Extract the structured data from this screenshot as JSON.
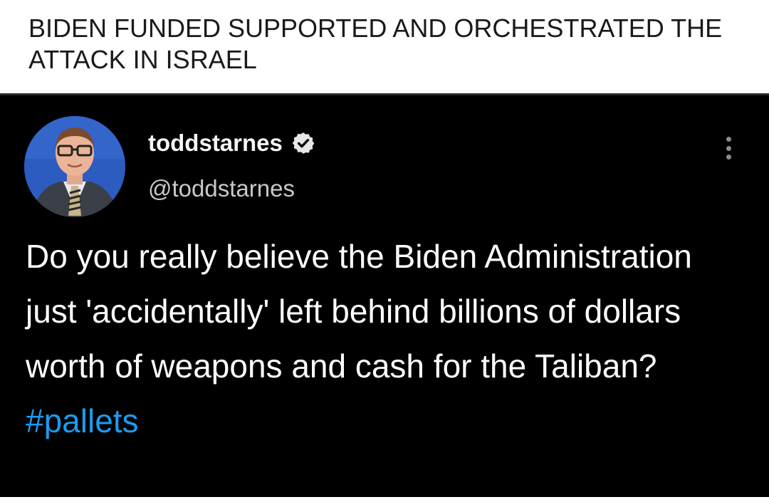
{
  "post": {
    "title": "BIDEN FUNDED SUPPORTED AND ORCHESTRATED THE ATTACK IN ISRAEL"
  },
  "tweet": {
    "display_name": "toddstarnes",
    "handle": "@toddstarnes",
    "verified_icon": "verified-badge-icon",
    "more_icon": "vertical-ellipsis-icon",
    "text": "Do you really believe the Biden Administration just 'accidentally' left behind billions of dollars worth of weapons and cash for the Taliban?",
    "hashtag": "#pallets",
    "hashtag_color": "#1d9bf0",
    "background_color": "#000000"
  }
}
